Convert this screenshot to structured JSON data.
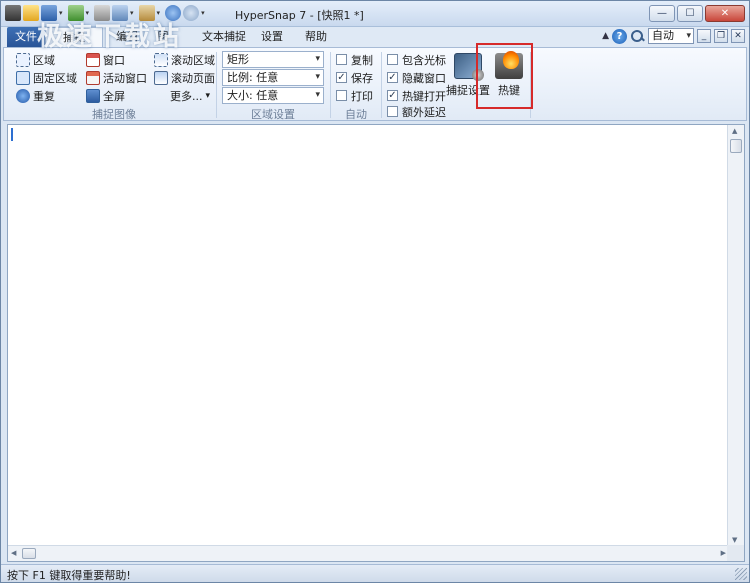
{
  "window": {
    "title": "HyperSnap 7 - [快照1 *]",
    "minimize": "—",
    "maximize": "☐",
    "close": "✕"
  },
  "watermark": "极速下载站",
  "menu": {
    "items": [
      "文件",
      "捕捉",
      "编辑",
      "图",
      "文本捕捉",
      "设置",
      "帮助"
    ]
  },
  "toolbar_right": {
    "help": "?",
    "zoom": "自动",
    "mdi_minimize": "_",
    "mdi_restore": "❐",
    "mdi_close": "✕"
  },
  "ribbon": {
    "capture_image": {
      "label": "捕捉图像",
      "col1": [
        "区域",
        "固定区域",
        "重复"
      ],
      "col2": [
        "窗口",
        "活动窗口",
        "全屏"
      ],
      "col3": [
        "滚动区域",
        "滚动页面",
        "更多..."
      ]
    },
    "region_settings": {
      "label": "区域设置",
      "shape": "矩形",
      "ratio": "比例: 任意",
      "size": "大小: 任意"
    },
    "auto": {
      "label": "自动",
      "items": [
        {
          "label": "复制",
          "checked": false
        },
        {
          "label": "保存",
          "checked": true
        },
        {
          "label": "打印",
          "checked": false
        }
      ]
    },
    "options": {
      "items": [
        {
          "label": "包含光标",
          "checked": false
        },
        {
          "label": "隐藏窗口",
          "checked": true
        },
        {
          "label": "热键打开",
          "checked": true
        },
        {
          "label": "额外延迟",
          "checked": false
        }
      ]
    },
    "capture_settings": "捕捉设置",
    "hotkey": "热键"
  },
  "status": {
    "text": "按下 F1 键取得重要帮助!"
  },
  "colors": {
    "highlight": "#d62a2a",
    "accent": "#2a5598"
  }
}
